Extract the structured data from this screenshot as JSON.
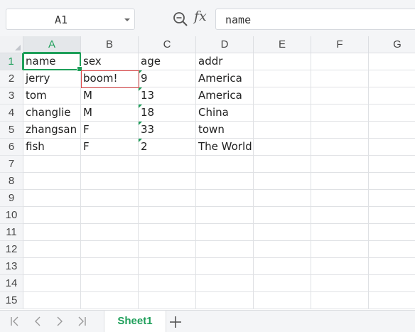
{
  "formula_bar": {
    "name_box": "A1",
    "fx_label": "fx",
    "formula": "name"
  },
  "columns": [
    "A",
    "B",
    "C",
    "D",
    "E",
    "F",
    "G"
  ],
  "rows": [
    "1",
    "2",
    "3",
    "4",
    "5",
    "6",
    "7",
    "8",
    "9",
    "10",
    "11",
    "12",
    "13",
    "14",
    "15"
  ],
  "cells": [
    [
      "name",
      "sex",
      "age",
      "addr"
    ],
    [
      "jerry",
      "boom!",
      "9",
      "America"
    ],
    [
      "tom",
      "M",
      "13",
      "America"
    ],
    [
      "changlie",
      "M",
      "18",
      "China"
    ],
    [
      "zhangsan",
      "F",
      "33",
      "town"
    ],
    [
      "fish",
      "F",
      "2",
      "The World"
    ]
  ],
  "active_cell": "A1",
  "sheet_tabs": [
    "Sheet1"
  ],
  "colors": {
    "accent": "#1e9f5a",
    "error_border": "#e04848"
  }
}
